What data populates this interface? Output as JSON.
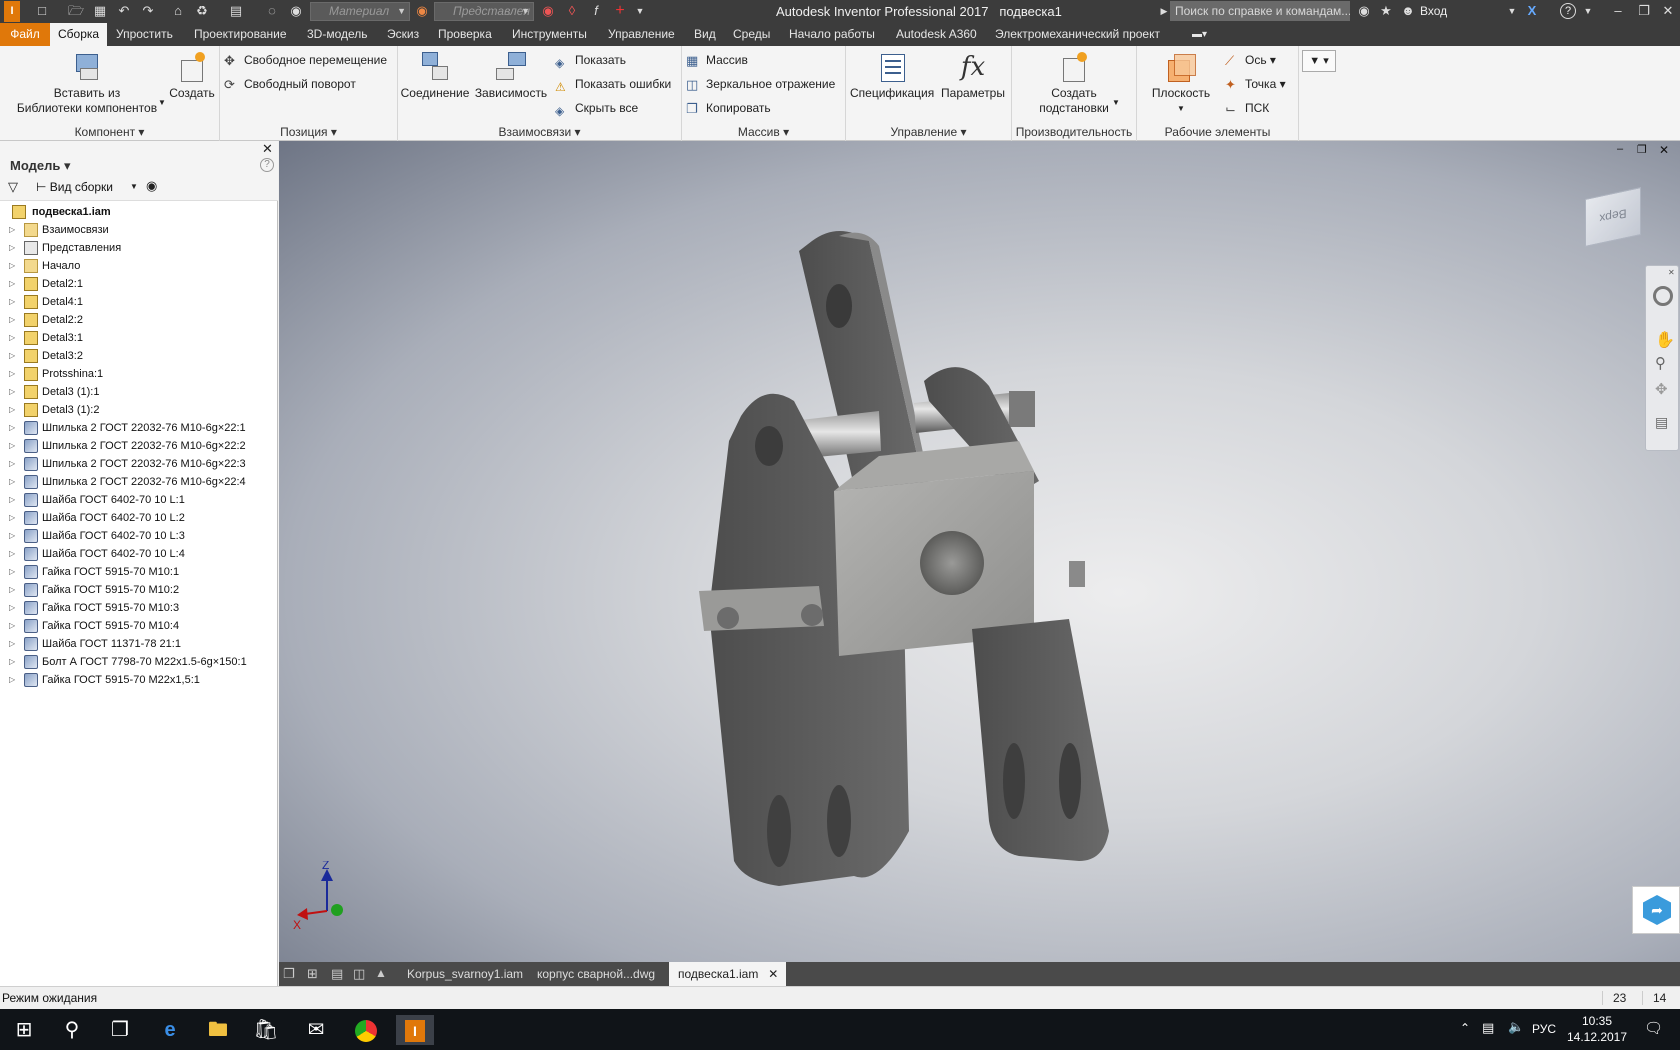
{
  "title_bar": {
    "app_title": "Autodesk Inventor Professional 2017",
    "doc_name": "подвеска1",
    "material_placeholder": "Материал",
    "view_placeholder": "Представлен",
    "help_search": "Поиск по справке и командам...",
    "sign_in": "Вход",
    "help": "?"
  },
  "menu": {
    "file": "Файл",
    "items": [
      "Сборка",
      "Упростить",
      "Проектирование",
      "3D-модель",
      "Эскиз",
      "Проверка",
      "Инструменты",
      "Управление",
      "Вид",
      "Среды",
      "Начало работы",
      "Autodesk A360",
      "Электромеханический проект"
    ]
  },
  "ribbon": {
    "component": {
      "title": "Компонент",
      "insert_line1": "Вставить из",
      "insert_line2": "Библиотеки компонентов",
      "create": "Создать"
    },
    "position": {
      "title": "Позиция",
      "free_move": "Свободное перемещение",
      "free_rotate": "Свободный поворот"
    },
    "relations": {
      "title": "Взаимосвязи",
      "joint": "Соединение",
      "constraint": "Зависимость",
      "show": "Показать",
      "show_errors": "Показать ошибки",
      "hide_all": "Скрыть все"
    },
    "pattern": {
      "title": "Массив",
      "pattern": "Массив",
      "mirror": "Зеркальное отражение",
      "copy": "Копировать"
    },
    "manage": {
      "title": "Управление",
      "bom": "Спецификация",
      "params": "Параметры"
    },
    "productivity": {
      "title": "Производительность",
      "create_sub_line1": "Создать",
      "create_sub_line2": "подстановки"
    },
    "work": {
      "title": "Рабочие элементы",
      "plane": "Плоскость",
      "axis": "Ось",
      "point": "Точка",
      "ucs": "ПСК"
    }
  },
  "browser": {
    "header": "Модель",
    "view": "Вид сборки",
    "help": "?",
    "root": "подвеска1.iam",
    "nodes": [
      {
        "label": "Взаимосвязи",
        "icon": "folder-icon"
      },
      {
        "label": "Представления",
        "icon": "view-icon"
      },
      {
        "label": "Начало",
        "icon": "folder-icon"
      },
      {
        "label": "Detal2:1",
        "icon": "part-icon"
      },
      {
        "label": "Detal4:1",
        "icon": "part-icon"
      },
      {
        "label": "Detal2:2",
        "icon": "part-icon"
      },
      {
        "label": "Detal3:1",
        "icon": "part-icon"
      },
      {
        "label": "Detal3:2",
        "icon": "part-icon"
      },
      {
        "label": "Protsshina:1",
        "icon": "part-icon"
      },
      {
        "label": "Detal3 (1):1",
        "icon": "part-icon"
      },
      {
        "label": "Detal3 (1):2",
        "icon": "part-icon"
      },
      {
        "label": "Шпилька 2 ГОСТ 22032-76 M10-6g×22:1",
        "icon": "standard-part-icon"
      },
      {
        "label": "Шпилька 2 ГОСТ 22032-76 M10-6g×22:2",
        "icon": "standard-part-icon"
      },
      {
        "label": "Шпилька 2 ГОСТ 22032-76 M10-6g×22:3",
        "icon": "standard-part-icon"
      },
      {
        "label": "Шпилька 2 ГОСТ 22032-76 M10-6g×22:4",
        "icon": "standard-part-icon"
      },
      {
        "label": "Шайба ГОСТ 6402-70 10 L:1",
        "icon": "standard-part-icon"
      },
      {
        "label": "Шайба ГОСТ 6402-70 10 L:2",
        "icon": "standard-part-icon"
      },
      {
        "label": "Шайба ГОСТ 6402-70 10 L:3",
        "icon": "standard-part-icon"
      },
      {
        "label": "Шайба ГОСТ 6402-70 10 L:4",
        "icon": "standard-part-icon"
      },
      {
        "label": "Гайка ГОСТ 5915-70 M10:1",
        "icon": "standard-part-icon"
      },
      {
        "label": "Гайка ГОСТ 5915-70 M10:2",
        "icon": "standard-part-icon"
      },
      {
        "label": "Гайка ГОСТ 5915-70 M10:3",
        "icon": "standard-part-icon"
      },
      {
        "label": "Гайка ГОСТ 5915-70 M10:4",
        "icon": "standard-part-icon"
      },
      {
        "label": "Шайба  ГОСТ 11371-78 21:1",
        "icon": "standard-part-icon"
      },
      {
        "label": "Болт А ГОСТ 7798-70 M22x1.5-6g×150:1",
        "icon": "standard-part-icon"
      },
      {
        "label": "Гайка ГОСТ 5915-70 M22x1,5:1",
        "icon": "standard-part-icon"
      }
    ]
  },
  "viewport": {
    "viewcube_label": "Верх",
    "axis_x": "X",
    "axis_z": "Z"
  },
  "doc_tabs": [
    "Korpus_svarnoy1.iam",
    "корпус сварной...dwg",
    "подвеска1.iam"
  ],
  "status": {
    "text": "Режим ожидания",
    "count1": "23",
    "count2": "14"
  },
  "taskbar": {
    "lang": "РУС",
    "time": "10:35",
    "date": "14.12.2017"
  },
  "colors": {
    "accent": "#e0780a",
    "titlebar": "#3c3c3c",
    "ribbon": "#f4f4f4"
  }
}
